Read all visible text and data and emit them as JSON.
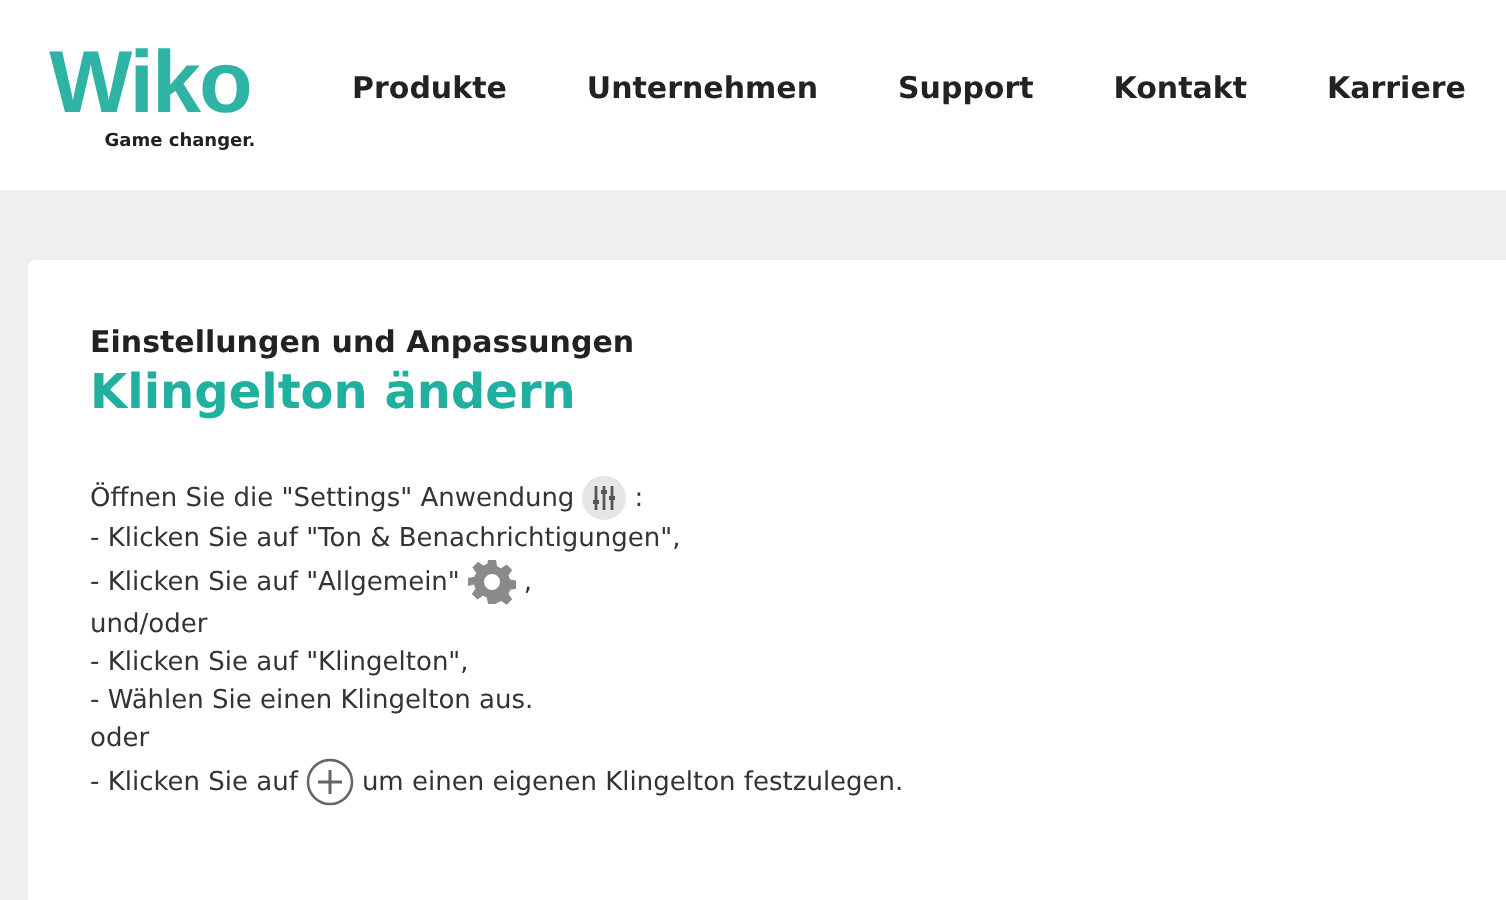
{
  "logo": {
    "name": "Wiko",
    "tagline": "Game changer."
  },
  "nav": [
    "Produkte",
    "Unternehmen",
    "Support",
    "Kontakt",
    "Karriere"
  ],
  "article": {
    "category": "Einstellungen und Anpassungen",
    "title": "Klingelton ändern",
    "lines": [
      {
        "kind": "sliders",
        "text": "Öffnen Sie die \"Settings\" Anwendung",
        "after": ":"
      },
      {
        "kind": "plain",
        "text": "- Klicken Sie auf \"Ton & Benachrichtigungen\","
      },
      {
        "kind": "gear",
        "text": "- Klicken Sie auf  \"Allgemein\"",
        "after": ","
      },
      {
        "kind": "plain",
        "text": "und/oder"
      },
      {
        "kind": "plain",
        "text": "- Klicken Sie auf \"Klingelton\","
      },
      {
        "kind": "plain",
        "text": "- Wählen Sie einen Klingelton aus."
      },
      {
        "kind": "plain",
        "text": "oder"
      },
      {
        "kind": "plus",
        "text": "- Klicken Sie auf",
        "after": "um einen eigenen Klingelton festzulegen."
      }
    ]
  }
}
